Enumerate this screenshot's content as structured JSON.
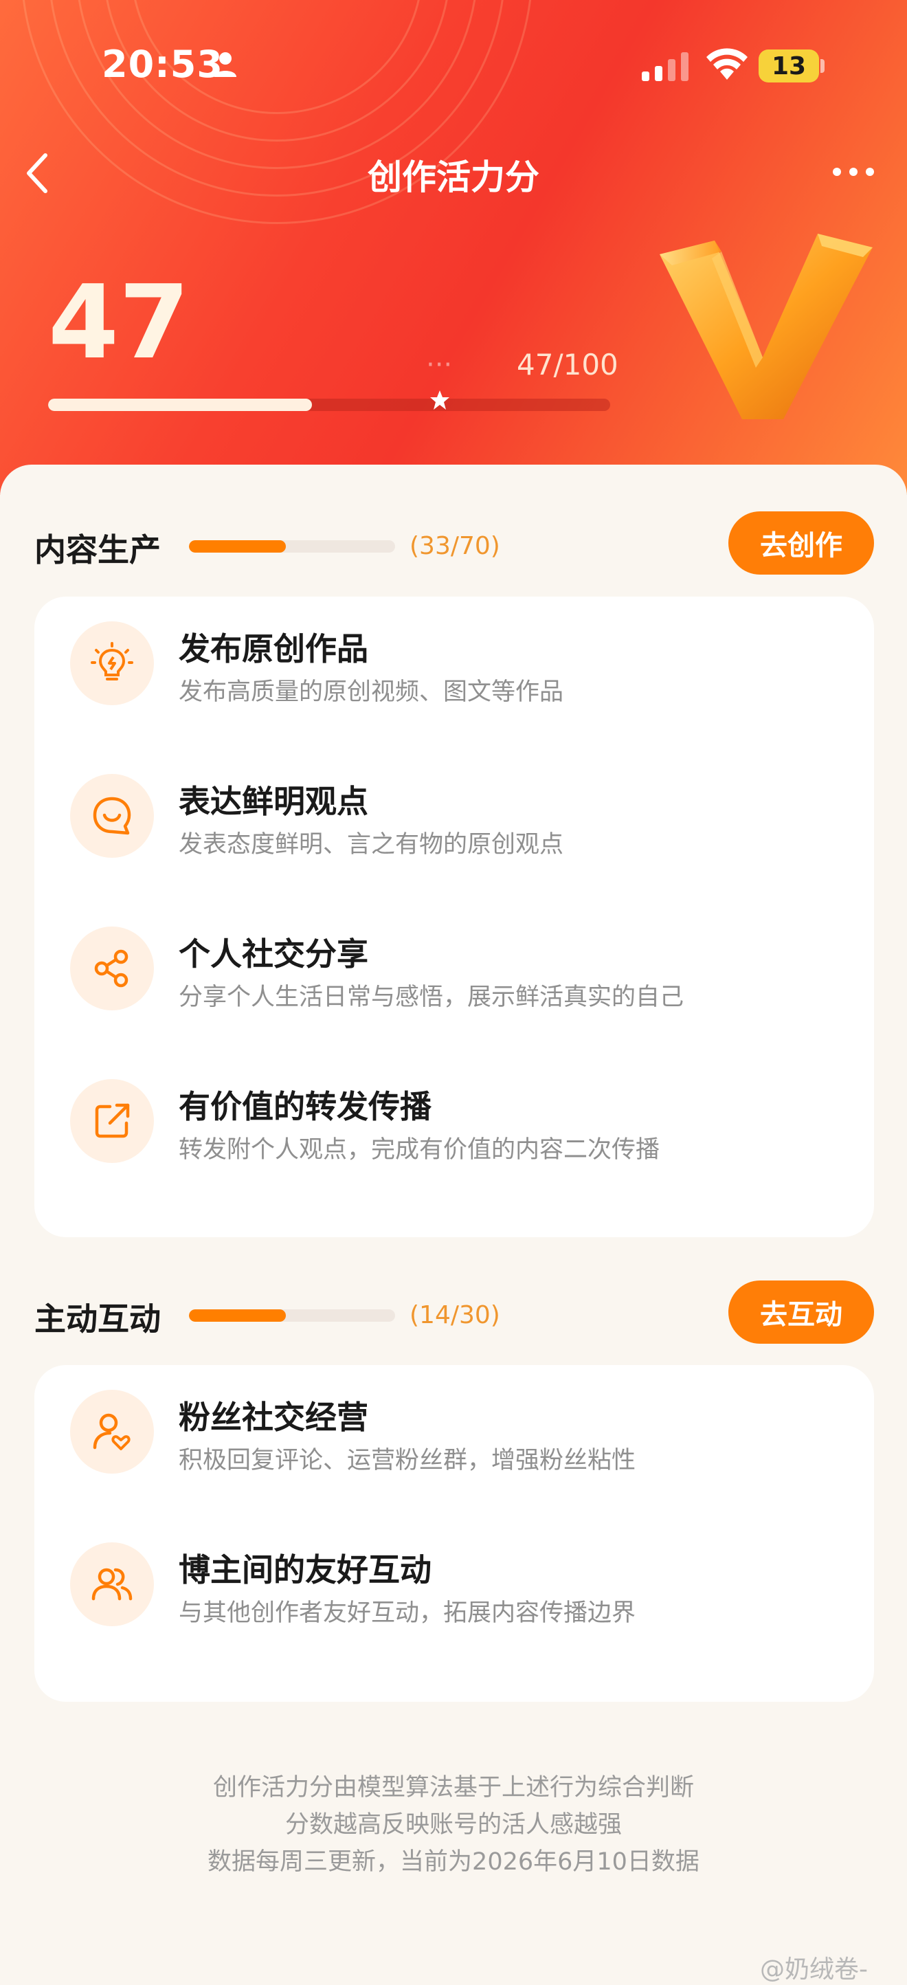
{
  "status_bar": {
    "time": "20:53",
    "battery": "13"
  },
  "header": {
    "title": "创作活力分",
    "score": "47",
    "level_label": "⋅⋅⋅",
    "level_value": "47/100",
    "progress": 0.47
  },
  "sections": [
    {
      "title": "内容生产",
      "count": "(33/70)",
      "progress": 0.47,
      "button": "去创作",
      "items": [
        {
          "title": "发布原创作品",
          "desc": "发布高质量的原创视频、图文等作品",
          "icon": "lightbulb-icon"
        },
        {
          "title": "表达鲜明观点",
          "desc": "发表态度鲜明、言之有物的原创观点",
          "icon": "smile-chat-icon"
        },
        {
          "title": "个人社交分享",
          "desc": "分享个人生活日常与感悟，展示鲜活真实的自己",
          "icon": "share-icon"
        },
        {
          "title": "有价值的转发传播",
          "desc": "转发附个人观点，完成有价值的内容二次传播",
          "icon": "forward-icon"
        }
      ]
    },
    {
      "title": "主动互动",
      "count": "(14/30)",
      "progress": 0.47,
      "button": "去互动",
      "items": [
        {
          "title": "粉丝社交经营",
          "desc": "积极回复评论、运营粉丝群，增强粉丝粘性",
          "icon": "user-heart-icon"
        },
        {
          "title": "博主间的友好互动",
          "desc": "与其他创作者友好互动，拓展内容传播边界",
          "icon": "users-icon"
        }
      ]
    }
  ],
  "footer": {
    "line1": "创作活力分由模型算法基于上述行为综合判断",
    "line2": "分数越高反映账号的活人感越强",
    "line3": "数据每周三更新，当前为2026年6月10日数据"
  },
  "watermark": "@奶绒卷-",
  "colors": {
    "accent": "#ff7e07",
    "header_red": "#f4372c",
    "icon_bg": "#fff0e3"
  }
}
